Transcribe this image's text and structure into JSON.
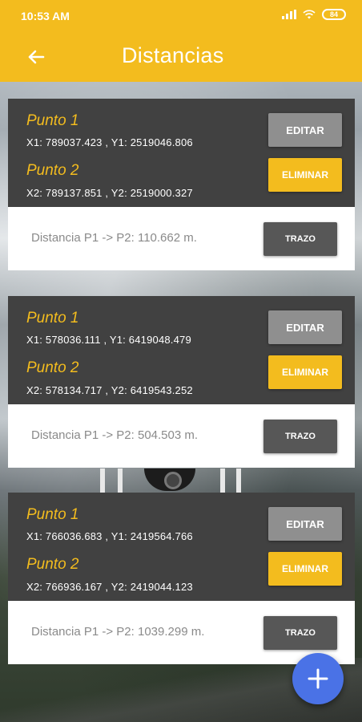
{
  "status_bar": {
    "time": "10:53 AM",
    "battery": "84"
  },
  "header": {
    "title": "Distancias"
  },
  "cards": [
    {
      "p1_label": "Punto 1",
      "p1_coords": "X1: 789037.423 , Y1: 2519046.806",
      "p2_label": "Punto 2",
      "p2_coords": "X2: 789137.851 , Y2: 2519000.327",
      "edit_label": "EDITAR",
      "delete_label": "ELIMINAR",
      "distance_text": "Distancia P1 -> P2: 110.662 m.",
      "trazo_label": "TRAZO"
    },
    {
      "p1_label": "Punto 1",
      "p1_coords": "X1: 578036.111 , Y1: 6419048.479",
      "p2_label": "Punto 2",
      "p2_coords": "X2: 578134.717 , Y2: 6419543.252",
      "edit_label": "EDITAR",
      "delete_label": "ELIMINAR",
      "distance_text": "Distancia P1 -> P2: 504.503 m.",
      "trazo_label": "TRAZO"
    },
    {
      "p1_label": "Punto 1",
      "p1_coords": "X1: 766036.683 , Y1: 2419564.766",
      "p2_label": "Punto 2",
      "p2_coords": "X2: 766936.167 , Y2: 2419044.123",
      "edit_label": "EDITAR",
      "delete_label": "ELIMINAR",
      "distance_text": "Distancia P1 -> P2: 1039.299 m.",
      "trazo_label": "TRAZO"
    }
  ],
  "icons": {
    "back": "arrow-left-icon",
    "fab": "plus-icon",
    "signal": "signal-icon",
    "wifi": "wifi-icon",
    "battery": "battery-icon"
  },
  "colors": {
    "accent": "#f3bc1e",
    "card_dark": "#414141",
    "edit_button": "#8f8f8f",
    "trazo_button": "#575757",
    "fab": "#4a72e6"
  }
}
